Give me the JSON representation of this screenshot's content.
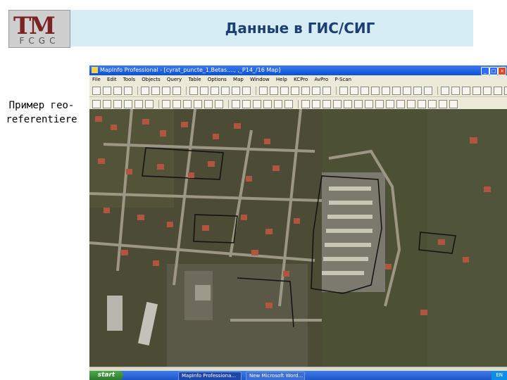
{
  "slide": {
    "logo_text": "TM",
    "logo_sub": "FCGC",
    "title": "Данные в ГИС/СИГ",
    "side_caption_line1": "Пример гео-",
    "side_caption_line2": "referentiere"
  },
  "window": {
    "title": "MapInfo Professional - [cyrat_puncte_1,Betas...., ,_P14_/16 Map]",
    "menu": [
      "File",
      "Edit",
      "Tools",
      "Objects",
      "Query",
      "Table",
      "Options",
      "Map",
      "Window",
      "Help",
      "KCPro",
      "AvPro",
      "P-Scan"
    ]
  },
  "taskbar": {
    "start_label": "start",
    "task1": "MapInfo Professiona...",
    "task2": "New Microsoft Word...",
    "tray": "EN"
  },
  "colors": {
    "title_bg": "#d7edf5",
    "title_text": "#1b3f72",
    "logo_red": "#7a2323",
    "map_soil": "#4b4b36",
    "roof_red": "#b2553e",
    "xp_blue": "#0a50d8"
  }
}
